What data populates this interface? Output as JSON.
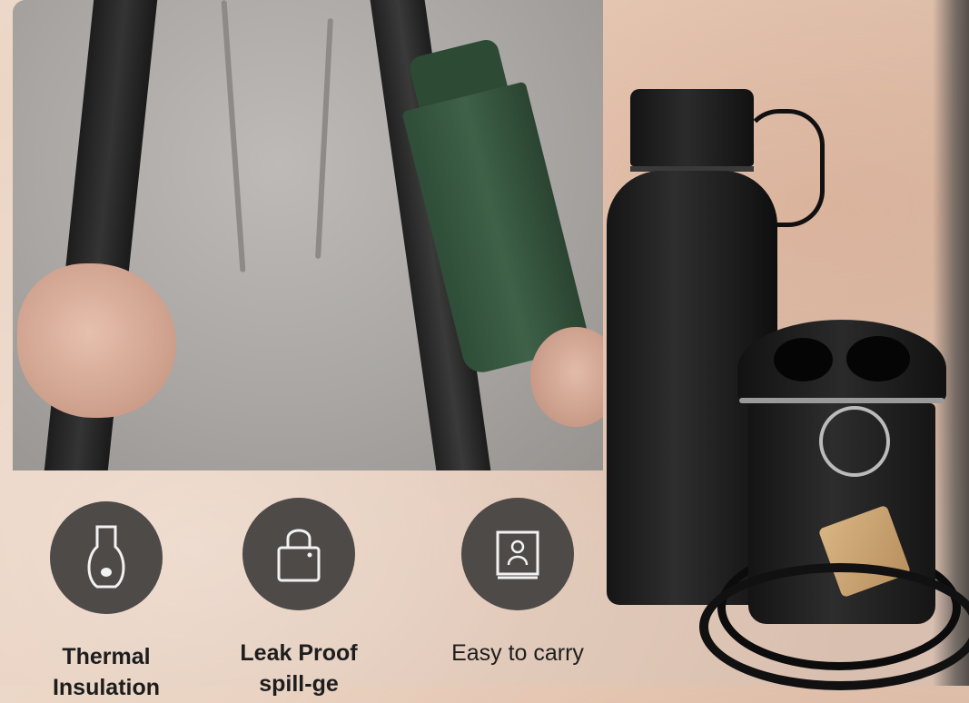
{
  "features": [
    {
      "label_line1": "Thermal",
      "label_line2": "Insulation",
      "icon": "thermos-icon"
    },
    {
      "label_line1": "Leak Proof",
      "label_line2": "spill-ge",
      "icon": "padlock-icon"
    },
    {
      "label_line1": "Easy to carry",
      "label_line2": "",
      "icon": "carry-card-icon"
    }
  ],
  "colors": {
    "icon_circle": "#4e4a48",
    "background": "#e6cbb8",
    "text": "#1d1d1d"
  }
}
